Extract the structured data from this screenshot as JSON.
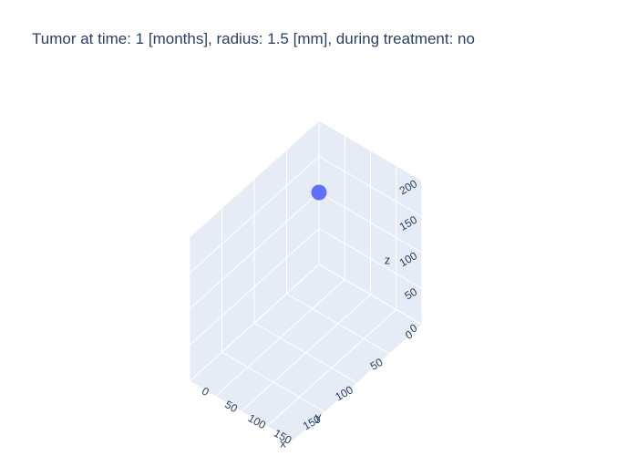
{
  "chart_data": {
    "type": "scatter3d",
    "title": "Tumor at time: 1 [months], radius: 1.5 [mm], during treatment: no",
    "axes": {
      "x": {
        "label": "x",
        "ticks": [
          0,
          50,
          100,
          150
        ],
        "range": [
          0,
          200
        ]
      },
      "y": {
        "label": "y",
        "ticks": [
          0,
          50,
          100,
          150
        ],
        "range": [
          0,
          200
        ]
      },
      "z": {
        "label": "z",
        "ticks": [
          0,
          50,
          100,
          150,
          200
        ],
        "range": [
          0,
          200
        ]
      }
    },
    "points": [
      {
        "x": 0,
        "y": 0,
        "z": 100
      }
    ],
    "marker_color": "#636efa",
    "pane_color": "#e5ecf6",
    "grid_color": "#ffffff",
    "grid": true
  }
}
